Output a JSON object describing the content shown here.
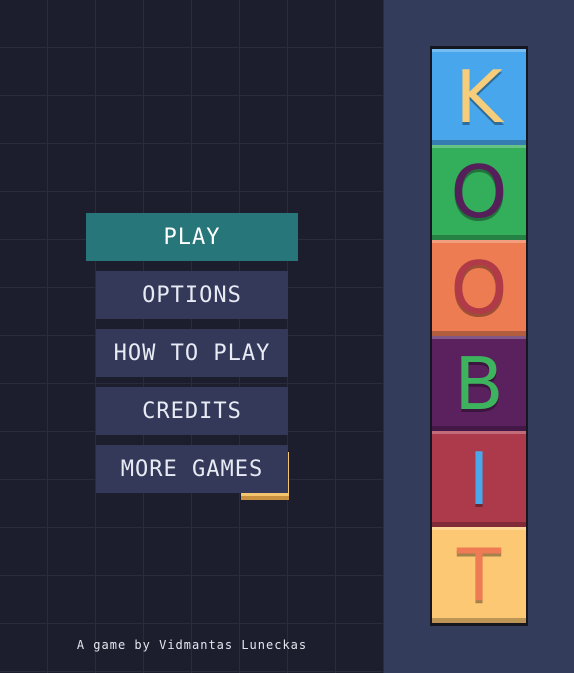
{
  "menu": {
    "items": [
      {
        "label": "PLAY",
        "active": true
      },
      {
        "label": "OPTIONS",
        "active": false
      },
      {
        "label": "HOW TO PLAY",
        "active": false
      },
      {
        "label": "CREDITS",
        "active": false
      },
      {
        "label": "MORE GAMES",
        "active": false
      }
    ]
  },
  "footer": {
    "credit": "A game by Vidmantas Luneckas"
  },
  "logo": {
    "letters": [
      {
        "char": "K",
        "tile_color": "#47a6ec",
        "letter_color": "#f6cd7a"
      },
      {
        "char": "O",
        "tile_color": "#33ae5b",
        "letter_color": "#55205a"
      },
      {
        "char": "O",
        "tile_color": "#ee7c52",
        "letter_color": "#b03a48"
      },
      {
        "char": "B",
        "tile_color": "#5b215e",
        "letter_color": "#3eb35e"
      },
      {
        "char": "I",
        "tile_color": "#ac3a4b",
        "letter_color": "#4aa8ea"
      },
      {
        "char": "T",
        "tile_color": "#fcc873",
        "letter_color": "#ef7b55"
      }
    ]
  },
  "colors": {
    "background": "#1d1e2d",
    "grid_line": "#2a2c3e",
    "side_panel": "#343c5b",
    "button": "#34395a",
    "button_active": "#26767a",
    "peek_tile": "#f4c56e"
  }
}
